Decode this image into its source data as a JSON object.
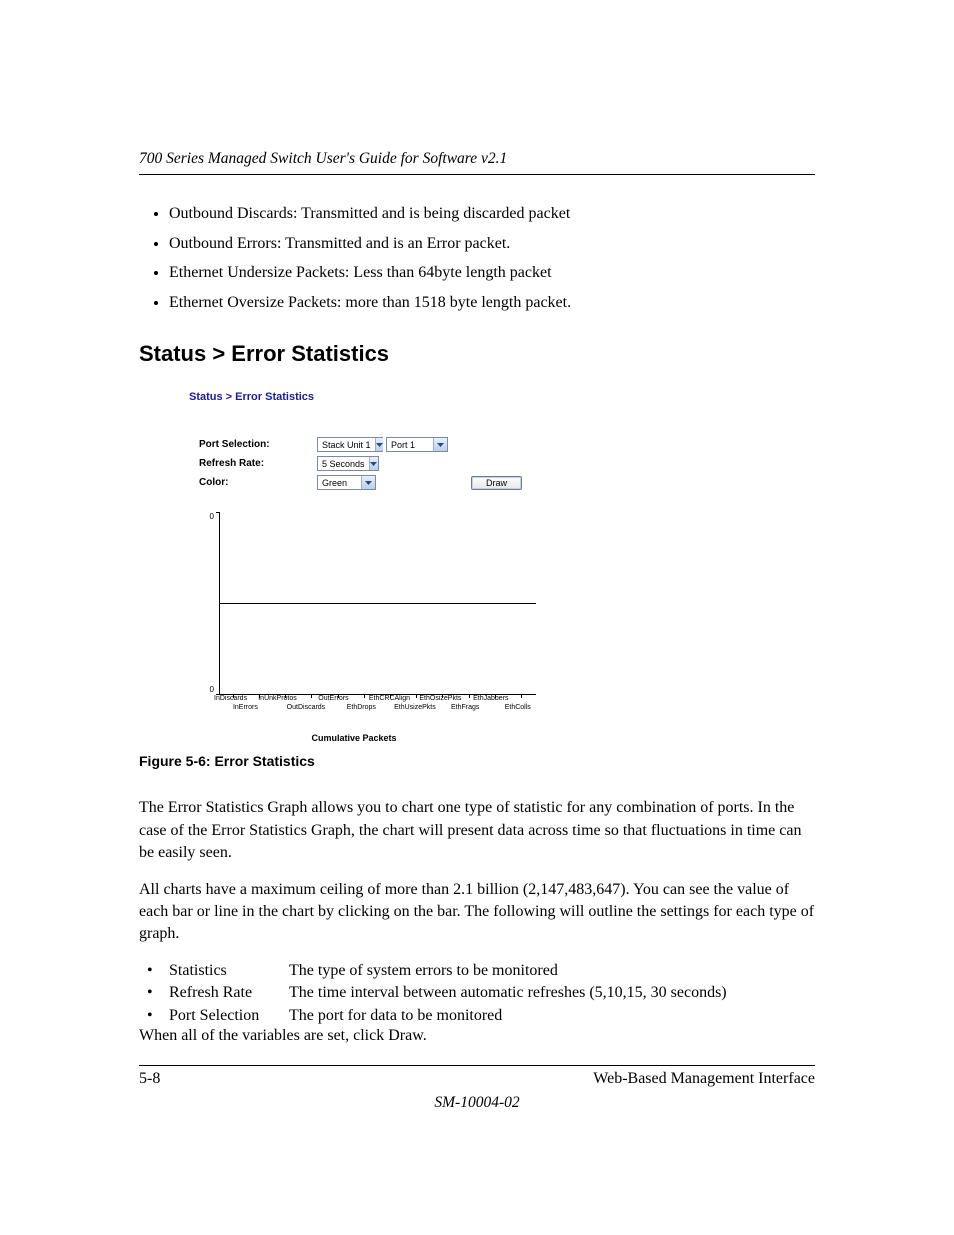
{
  "header": {
    "running": "700 Series Managed Switch User's Guide for Software v2.1"
  },
  "top_bullets": [
    "Outbound Discards: Transmitted and is being discarded packet",
    "Outbound Errors: Transmitted and is an Error packet.",
    "Ethernet Undersize Packets: Less than 64byte length packet",
    "Ethernet Oversize Packets: more than 1518 byte length packet."
  ],
  "section_heading": "Status > Error Statistics",
  "figure": {
    "inner_title": "Status > Error Statistics",
    "form": {
      "port_label": "Port Selection:",
      "port_unit_value": "Stack Unit 1",
      "port_value": "Port 1",
      "refresh_label": "Refresh Rate:",
      "refresh_value": "5 Seconds",
      "color_label": "Color:",
      "color_value": "Green",
      "draw_label": "Draw"
    },
    "chart_data": {
      "type": "bar",
      "title": "Cumulative Packets",
      "xlabel": "",
      "ylabel": "",
      "ylim": [
        0,
        0
      ],
      "yticks": [
        "0",
        "0"
      ],
      "categories": [
        "InDiscards",
        "InErrors",
        "InUnkProtos",
        "OutDiscards",
        "OutErrors",
        "EthDrops",
        "EthCRCAlign",
        "EthUsizePkts",
        "EthOsizePkts",
        "EthFrags",
        "EthJabbers",
        "EthColls"
      ],
      "values": [
        0,
        0,
        0,
        0,
        0,
        0,
        0,
        0,
        0,
        0,
        0,
        0
      ]
    },
    "caption": "Figure 5-6:  Error Statistics"
  },
  "body1": "The Error Statistics Graph allows you to chart one type of statistic for any combination of ports. In the case of the Error Statistics Graph, the chart will present data across time so that fluctuations in time can be easily seen.",
  "body2": "All charts have a maximum ceiling of more than 2.1 billion (2,147,483,647). You can see the value of each bar or line in the chart by clicking on the bar. The following will outline the settings for each type of graph.",
  "defs": [
    {
      "term": "Statistics",
      "desc": "The type of system errors to be monitored"
    },
    {
      "term": "Refresh Rate",
      "desc": "The time interval between automatic refreshes (5,10,15, 30 seconds)"
    },
    {
      "term": "Port Selection",
      "desc": "The port for data to be monitored"
    }
  ],
  "after_defs": "When all of the variables are set, click Draw.",
  "footer": {
    "page": "5-8",
    "section": "Web-Based Management Interface",
    "docid": "SM-10004-02"
  }
}
